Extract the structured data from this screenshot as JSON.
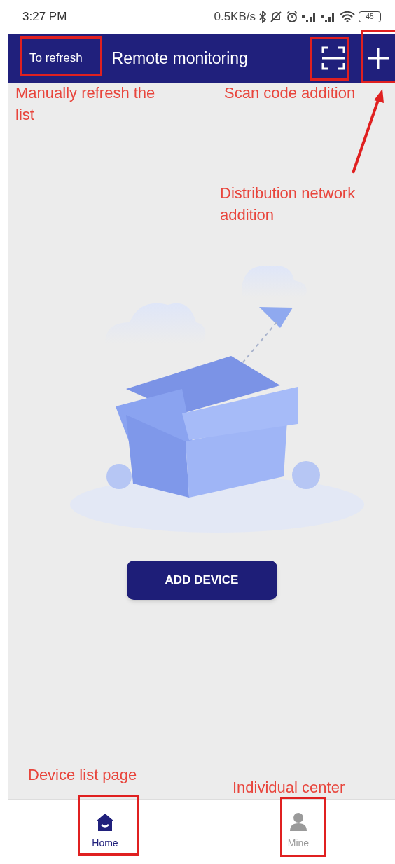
{
  "status_bar": {
    "time": "3:27 PM",
    "speed": "0.5KB/s",
    "battery": "45"
  },
  "header": {
    "refresh_button": "To refresh",
    "title": "Remote monitoring"
  },
  "empty_state": {
    "kind": "picture",
    "button": "ADD DEVICE"
  },
  "bottom_nav": [
    {
      "label": "Home",
      "selected": true
    },
    {
      "label": "Mine",
      "selected": false
    }
  ],
  "annotations": [
    {
      "text": "Manually refresh the list"
    },
    {
      "text": "Scan code addition"
    },
    {
      "text": "Distribution network addition"
    },
    {
      "text": "Device list page"
    },
    {
      "text": "Individual center"
    }
  ]
}
